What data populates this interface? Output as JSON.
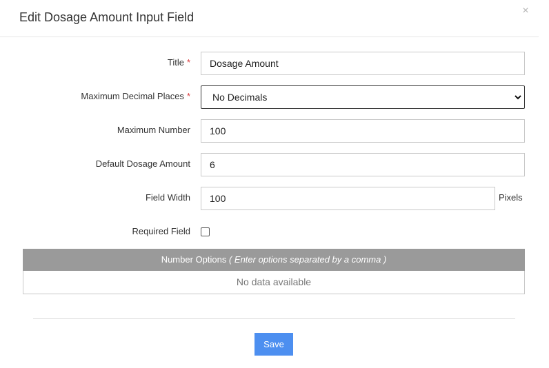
{
  "modal": {
    "title": "Edit Dosage Amount Input Field",
    "close_glyph": "×"
  },
  "form": {
    "title": {
      "label": "Title",
      "required_marker": "*",
      "value": "Dosage Amount"
    },
    "max_decimal_places": {
      "label": "Maximum Decimal Places",
      "required_marker": "*",
      "selected": "No Decimals"
    },
    "max_number": {
      "label": "Maximum Number",
      "value": "100"
    },
    "default_dosage_amount": {
      "label": "Default Dosage Amount",
      "value": "6"
    },
    "field_width": {
      "label": "Field Width",
      "value": "100",
      "unit": "Pixels"
    },
    "required_field": {
      "label": "Required Field",
      "checked": false
    }
  },
  "number_options": {
    "header": "Number Options",
    "hint": "( Enter options separated by a comma )",
    "empty_text": "No data available"
  },
  "footer": {
    "save_label": "Save"
  },
  "colors": {
    "required": "#d9383a",
    "table_header_bg": "#9a9a9a",
    "primary_button": "#4d8ff0"
  },
  "icons": {
    "close": "close-icon",
    "select_arrow": "chevron-down-icon"
  }
}
